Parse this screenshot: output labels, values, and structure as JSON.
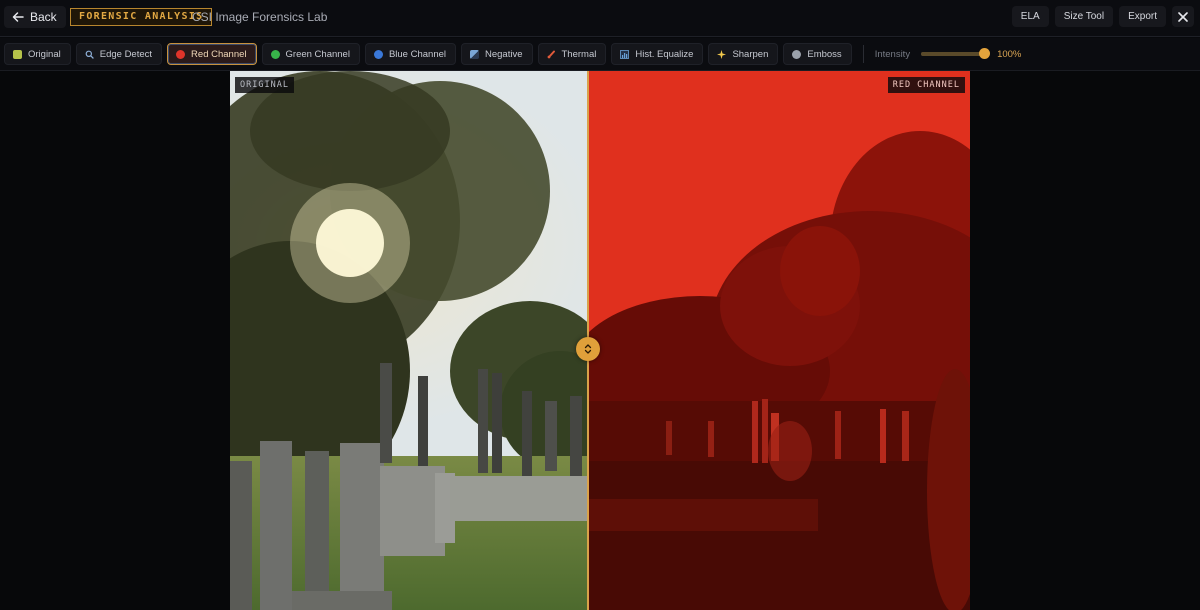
{
  "header": {
    "back_label": "Back",
    "badge": "FORENSIC ANALYSIS",
    "title": "CSI Image Forensics Lab",
    "actions": [
      "ELA",
      "Size Tool",
      "Export"
    ]
  },
  "filters": {
    "items": [
      {
        "label": "Original",
        "icon": "image-icon",
        "color": "#b5c24a"
      },
      {
        "label": "Edge Detect",
        "icon": "magnifier-icon",
        "color": "#8fb0d8"
      },
      {
        "label": "Red Channel",
        "icon": "red-circle-icon",
        "color": "#e0342a"
      },
      {
        "label": "Green Channel",
        "icon": "green-circle-icon",
        "color": "#38b44a"
      },
      {
        "label": "Blue Channel",
        "icon": "blue-circle-icon",
        "color": "#3a78d8"
      },
      {
        "label": "Negative",
        "icon": "negative-icon",
        "color": "#7aa6d6"
      },
      {
        "label": "Thermal",
        "icon": "thermometer-icon",
        "color": "#e05a3a"
      },
      {
        "label": "Hist. Equalize",
        "icon": "histogram-icon",
        "color": "#6aa2d8"
      },
      {
        "label": "Sharpen",
        "icon": "sparkle-icon",
        "color": "#f2c94c"
      },
      {
        "label": "Emboss",
        "icon": "emboss-icon",
        "color": "#9aa0aa"
      }
    ],
    "active": "Red Channel",
    "intensity_label": "Intensity",
    "intensity_value": "100%",
    "intensity_fraction": 1.0
  },
  "viewer": {
    "left_label": "ORIGINAL",
    "right_label": "RED CHANNEL",
    "split_fraction": 0.484
  },
  "colors": {
    "accent": "#e0a03a",
    "red_channel": "#e0301e"
  }
}
